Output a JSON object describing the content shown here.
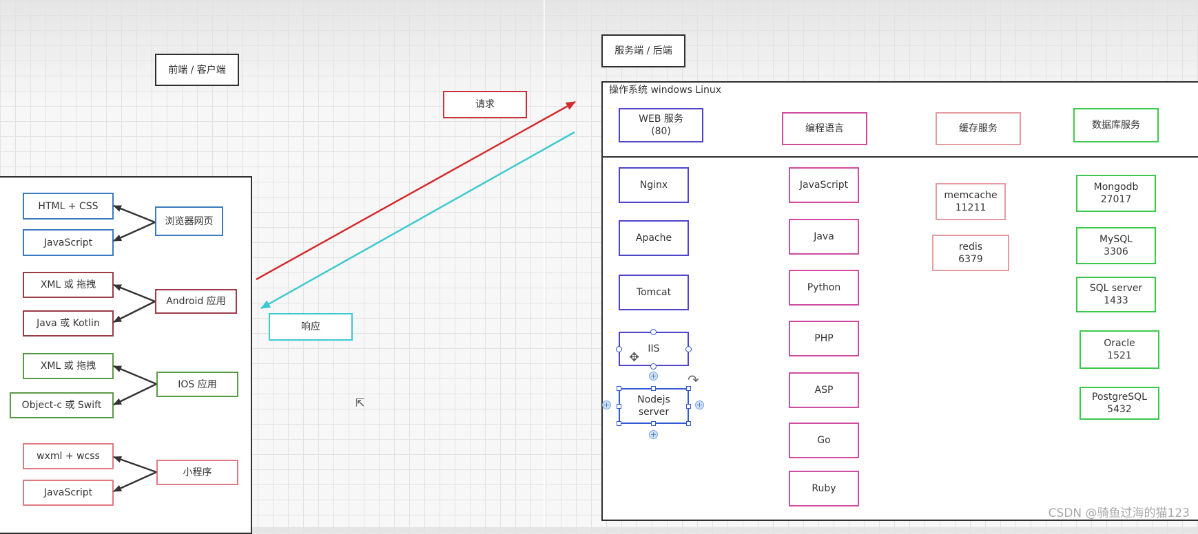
{
  "frontend": {
    "title": "前端 / 客户端",
    "browser": {
      "label": "浏览器网页",
      "items": [
        "HTML + CSS",
        "JavaScript"
      ]
    },
    "android": {
      "label": "Android 应用",
      "items": [
        "XML 或 拖拽",
        "Java 或 Kotlin"
      ]
    },
    "ios": {
      "label": "IOS 应用",
      "items": [
        "XML 或 拖拽",
        "Object-c 或 Swift"
      ]
    },
    "miniprogram": {
      "label": "小程序",
      "items": [
        "wxml + wcss",
        "JavaScript"
      ]
    }
  },
  "flow": {
    "request": "请求",
    "response": "响应"
  },
  "backend": {
    "title": "服务端 / 后端",
    "os": "操作系统  windows   Linux",
    "web": {
      "header": [
        "WEB 服务",
        "(80)"
      ],
      "items": [
        "Nginx",
        "Apache",
        "Tomcat",
        "IIS",
        [
          "Nodejs",
          "server"
        ]
      ]
    },
    "lang": {
      "header": "编程语言",
      "items": [
        "JavaScript",
        "Java",
        "Python",
        "PHP",
        "ASP",
        "Go",
        "Ruby"
      ]
    },
    "cache": {
      "header": "缓存服务",
      "items": [
        [
          "memcache",
          "11211"
        ],
        [
          "redis",
          "6379"
        ]
      ]
    },
    "db": {
      "header": "数据库服务",
      "items": [
        [
          "Mongodb",
          "27017"
        ],
        [
          "MySQL",
          "3306"
        ],
        [
          "SQL server",
          "1433"
        ],
        [
          "Oracle",
          "1521"
        ],
        [
          "PostgreSQL",
          "5432"
        ]
      ]
    }
  },
  "icons": [
    "move-icon",
    "rotate-icon",
    "cursor-icon"
  ],
  "colors": {
    "request_arrow": "#d42b2b",
    "response_arrow": "#3dc9cf",
    "browser": "#3a7bbf",
    "android": "#9a3b46",
    "ios": "#5b9a45",
    "miniprogram": "#e07a80",
    "web": "#4e44c8",
    "lang": "#cf4ba0",
    "cache": "#e69aa0",
    "db": "#3bc94a"
  },
  "watermark": "CSDN @骑鱼过海的猫123"
}
